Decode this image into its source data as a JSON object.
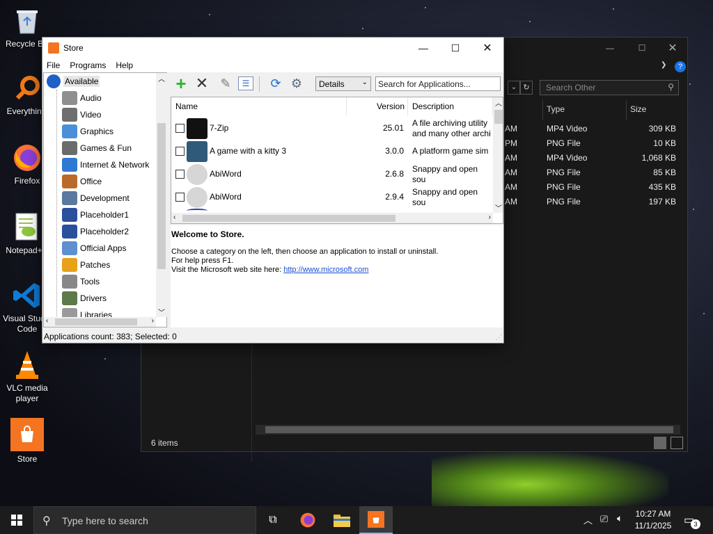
{
  "desktop": {
    "icons": [
      {
        "label": "Recycle Bin"
      },
      {
        "label": "Everything"
      },
      {
        "label": "Firefox"
      },
      {
        "label": "Notepad++"
      },
      {
        "label": "Visual Studio Code"
      },
      {
        "label": "VLC media player"
      },
      {
        "label": "Store"
      }
    ]
  },
  "explorer": {
    "search_placeholder": "Search Other",
    "columns": [
      "Type",
      "Size"
    ],
    "rows": [
      {
        "time": "AM",
        "type": "MP4 Video",
        "size": "309 KB"
      },
      {
        "time": "PM",
        "type": "PNG File",
        "size": "10 KB"
      },
      {
        "time": "AM",
        "type": "MP4 Video",
        "size": "1,068 KB"
      },
      {
        "time": "AM",
        "type": "PNG File",
        "size": "85 KB"
      },
      {
        "time": "AM",
        "type": "PNG File",
        "size": "435 KB"
      },
      {
        "time": "AM",
        "type": "PNG File",
        "size": "197 KB"
      }
    ],
    "status": "6 items"
  },
  "store": {
    "title": "Store",
    "menu": [
      "File",
      "Programs",
      "Help"
    ],
    "categories": [
      {
        "label": "Available",
        "selected": true
      },
      {
        "label": "Audio"
      },
      {
        "label": "Video"
      },
      {
        "label": "Graphics"
      },
      {
        "label": "Games & Fun"
      },
      {
        "label": "Internet & Network"
      },
      {
        "label": "Office"
      },
      {
        "label": "Development"
      },
      {
        "label": "Placeholder1"
      },
      {
        "label": "Placeholder2"
      },
      {
        "label": "Official Apps"
      },
      {
        "label": "Patches"
      },
      {
        "label": "Tools"
      },
      {
        "label": "Drivers"
      },
      {
        "label": "Libraries"
      }
    ],
    "view_select": "Details",
    "search_placeholder": "Search for Applications...",
    "columns": {
      "name": "Name",
      "version": "Version",
      "description": "Description"
    },
    "apps": [
      {
        "name": "7-Zip",
        "version": "25.01",
        "description": "A file archiving utility and many other archi"
      },
      {
        "name": "A game with a kitty 3",
        "version": "3.0.0",
        "description": "A platform game sim"
      },
      {
        "name": "AbiWord",
        "version": "2.6.8",
        "description": "Snappy and open sou"
      },
      {
        "name": "AbiWord",
        "version": "2.9.4",
        "description": "Snappy and open sou"
      }
    ],
    "info": {
      "heading": "Welcome to Store.",
      "line1": "Choose a category on the left, then choose an application to install or uninstall.",
      "line2": "For help press F1.",
      "line3_prefix": "Visit the Microsoft web site here: ",
      "link": "http://www.microsoft.com"
    },
    "status": "Applications count: 383; Selected: 0"
  },
  "taskbar": {
    "search_placeholder": "Type here to search",
    "time": "10:27 AM",
    "date": "11/1/2025",
    "notifications": "3"
  }
}
